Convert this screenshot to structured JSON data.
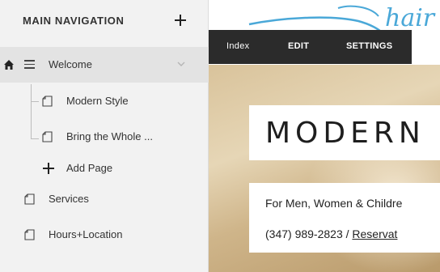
{
  "sidebar": {
    "header": {
      "title": "MAIN NAVIGATION",
      "add_icon": "plus-icon"
    },
    "items": [
      {
        "label": "Welcome",
        "icon": "home-icon",
        "type_icon": "list-icon",
        "expanded": true,
        "selected": true
      },
      {
        "label": "Modern Style",
        "icon": "page-icon",
        "child": true
      },
      {
        "label": "Bring the Whole ...",
        "icon": "page-icon",
        "child": true
      },
      {
        "label": "Add Page",
        "icon": "plus-icon",
        "child": true
      },
      {
        "label": "Services",
        "icon": "page-icon"
      },
      {
        "label": "Hours+Location",
        "icon": "page-icon"
      }
    ]
  },
  "toolbar": {
    "index": "Index",
    "edit": "EDIT",
    "settings": "SETTINGS"
  },
  "preview": {
    "logo_text": "hair",
    "accent_color": "#4aa8d8",
    "heading": "MODERN",
    "subtitle": "For Men, Women & Childre",
    "phone": "(347) 989-2823 / ",
    "reservation_link": "Reservat"
  }
}
